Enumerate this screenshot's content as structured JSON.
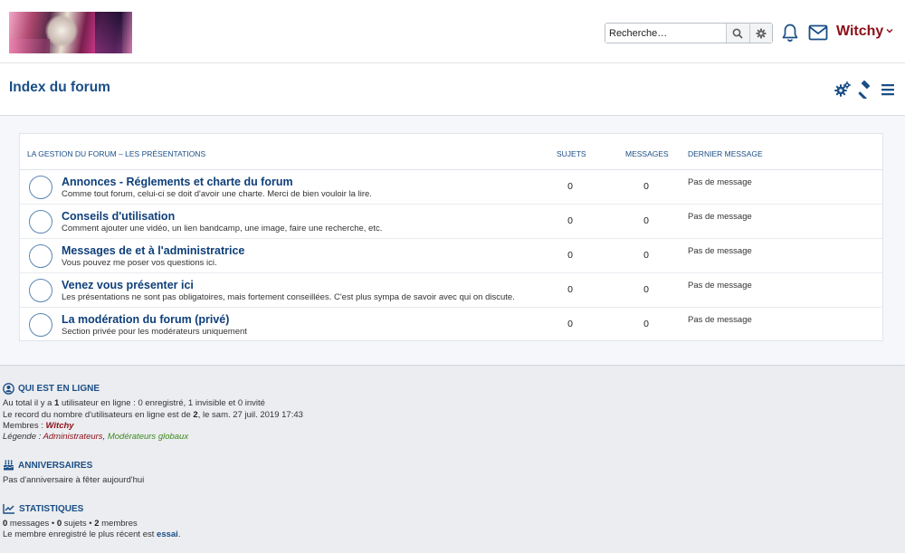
{
  "header": {
    "search": {
      "placeholder": "Recherche…"
    },
    "user": {
      "name": "Witchy"
    },
    "icons": [
      "search-icon",
      "gear-icon",
      "bell-icon",
      "envelope-icon",
      "chevron-down-icon"
    ]
  },
  "titlebar": {
    "title": "Index du forum",
    "icons": [
      "settings-icon",
      "moderation-hammer-icon",
      "menu-icon"
    ]
  },
  "forum": {
    "columns": {
      "category": "La gestion du forum – Les présentations",
      "topics": "Sujets",
      "messages": "Messages",
      "last": "Dernier message"
    },
    "rows": [
      {
        "title": "Annonces - Réglements et charte du forum",
        "desc": "Comme tout forum, celui-ci se doit d'avoir une charte. Merci de bien vouloir la lire.",
        "topics": "0",
        "messages": "0",
        "last": "Pas de message"
      },
      {
        "title": "Conseils d'utilisation",
        "desc": "Comment ajouter une vidéo, un lien bandcamp, une image, faire une recherche, etc.",
        "topics": "0",
        "messages": "0",
        "last": "Pas de message"
      },
      {
        "title": "Messages de et à l'administratrice",
        "desc": "Vous pouvez me poser vos questions ici.",
        "topics": "0",
        "messages": "0",
        "last": "Pas de message"
      },
      {
        "title": "Venez vous présenter ici",
        "desc": "Les présentations ne sont pas obligatoires, mais fortement conseillées. C'est plus sympa de savoir avec qui on discute.",
        "topics": "0",
        "messages": "0",
        "last": "Pas de message"
      },
      {
        "title": "La modération du forum (privé)",
        "desc": "Section privée pour les modérateurs uniquement",
        "topics": "0",
        "messages": "0",
        "last": "Pas de message"
      }
    ]
  },
  "online": {
    "heading": "Qui est en ligne",
    "l1_a": "Au total il y a ",
    "l1_count": "1",
    "l1_b": " utilisateur en ligne : 0 enregistré, 1 invisible et 0 invité",
    "l2_a": "Le record du nombre d'utilisateurs en ligne est de ",
    "l2_count": "2",
    "l2_b": ", le sam. 27 juil. 2019 17:43",
    "members_label": "Membres : ",
    "members_name": "Witchy",
    "legend_label": "Légende : ",
    "legend_admin": "Administrateurs",
    "legend_sep": ", ",
    "legend_mod": "Modérateurs globaux"
  },
  "birthdays": {
    "heading": "Anniversaires",
    "text": "Pas d'anniversaire à fêter aujourd'hui"
  },
  "statistics": {
    "heading": "Statistiques",
    "messages_count": "0",
    "messages_label": " messages • ",
    "topics_count": "0",
    "topics_label": " sujets • ",
    "members_count": "2",
    "members_label": " membres",
    "newest_a": "Le membre enregistré le plus récent est ",
    "newest_name": "essai",
    "newest_b": "."
  },
  "colors": {
    "primary": "#1a4e86",
    "admin": "#8c1017",
    "moderator": "#3e8a1e"
  }
}
